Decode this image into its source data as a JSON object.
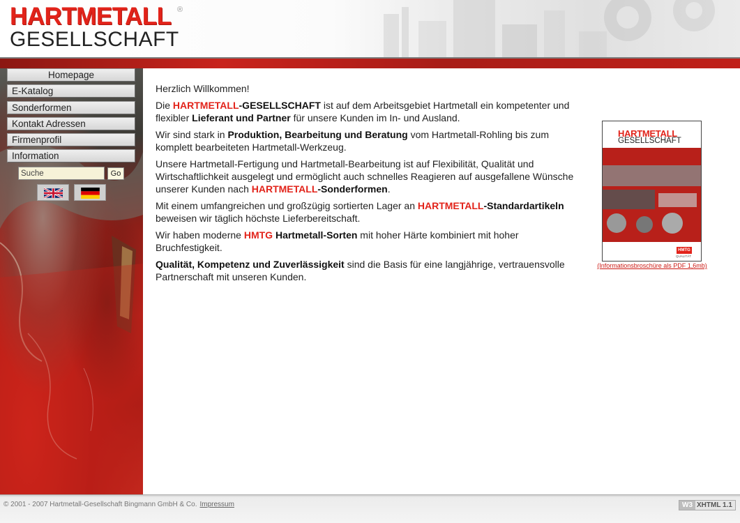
{
  "header": {
    "logo_top": "HARTMETALL",
    "logo_bottom": "GESELLSCHAFT",
    "logo_reg": "®"
  },
  "nav": {
    "items": [
      {
        "label": "Homepage"
      },
      {
        "label": "E-Katalog"
      },
      {
        "label": "Sonderformen"
      },
      {
        "label": "Kontakt Adressen"
      },
      {
        "label": "Firmenprofil"
      },
      {
        "label": "Information"
      }
    ]
  },
  "search": {
    "value": "Suche",
    "go_label": "Go"
  },
  "languages": [
    {
      "name": "English",
      "icon": "uk-flag-icon"
    },
    {
      "name": "Deutsch",
      "icon": "german-flag-icon"
    }
  ],
  "content": {
    "greeting": "Herzlich Willkommen!",
    "p1": {
      "a": "Die ",
      "red": "HARTMETALL",
      "b": "-GESELLSCHAFT",
      "c": " ist auf dem Arbeitsgebiet Hartmetall ein kompetenter und flexibler ",
      "d": "Lieferant und Partner",
      "e": " für unsere Kunden im In- und Ausland."
    },
    "p2": {
      "a": "Wir sind stark in ",
      "b": "Produktion, Bearbeitung und Beratung",
      "c": " vom Hartmetall-Rohling bis zum komplett bearbeiteten Hartmetall-Werkzeug."
    },
    "p3": {
      "a": "Unsere Hartmetall-Fertigung und Hartmetall-Bearbeitung ist auf Flexibilität, Qualität und Wirtschaftlichkeit ausgelegt und ermöglicht auch schnelles Reagieren auf ausgefallene Wünsche unserer Kunden nach ",
      "red": "HARTMETALL",
      "b": "-Sonderformen",
      "c": "."
    },
    "p4": {
      "a": "Mit einem umfangreichen und großzügig sortierten Lager an ",
      "red": "HARTMETALL",
      "b": "-Standardartikeln",
      "c": " beweisen wir täglich höchste Lieferbereitschaft."
    },
    "p5": {
      "a": "Wir haben moderne ",
      "red": "HMTG",
      "b": " Hartmetall-Sorten",
      "c": " mit hoher Härte kombiniert mit hoher Bruchfestigkeit."
    },
    "p6": {
      "b": "Qualität, Kompetenz und Zuverlässigkeit",
      "c": " sind die Basis für eine langjährige, vertrauensvolle Partnerschaft mit unseren Kunden."
    }
  },
  "brochure": {
    "logo_top": "HARTMETALL",
    "logo_bottom": "GESELLSCHAFT",
    "badge": "HMTG",
    "quality": "QUALITÄT",
    "link": "(Informationsbroschüre als PDF 1,6mb)"
  },
  "footer": {
    "copyright": "© 2001 - 2007 Hartmetall-Gesellschaft Bingmann GmbH & Co.",
    "impressum": "Impressum",
    "w3": "W3",
    "xhtml": "XHTML 1.1"
  },
  "colors": {
    "brand_red": "#e2231a",
    "sidebar_red": "#c2231b"
  }
}
